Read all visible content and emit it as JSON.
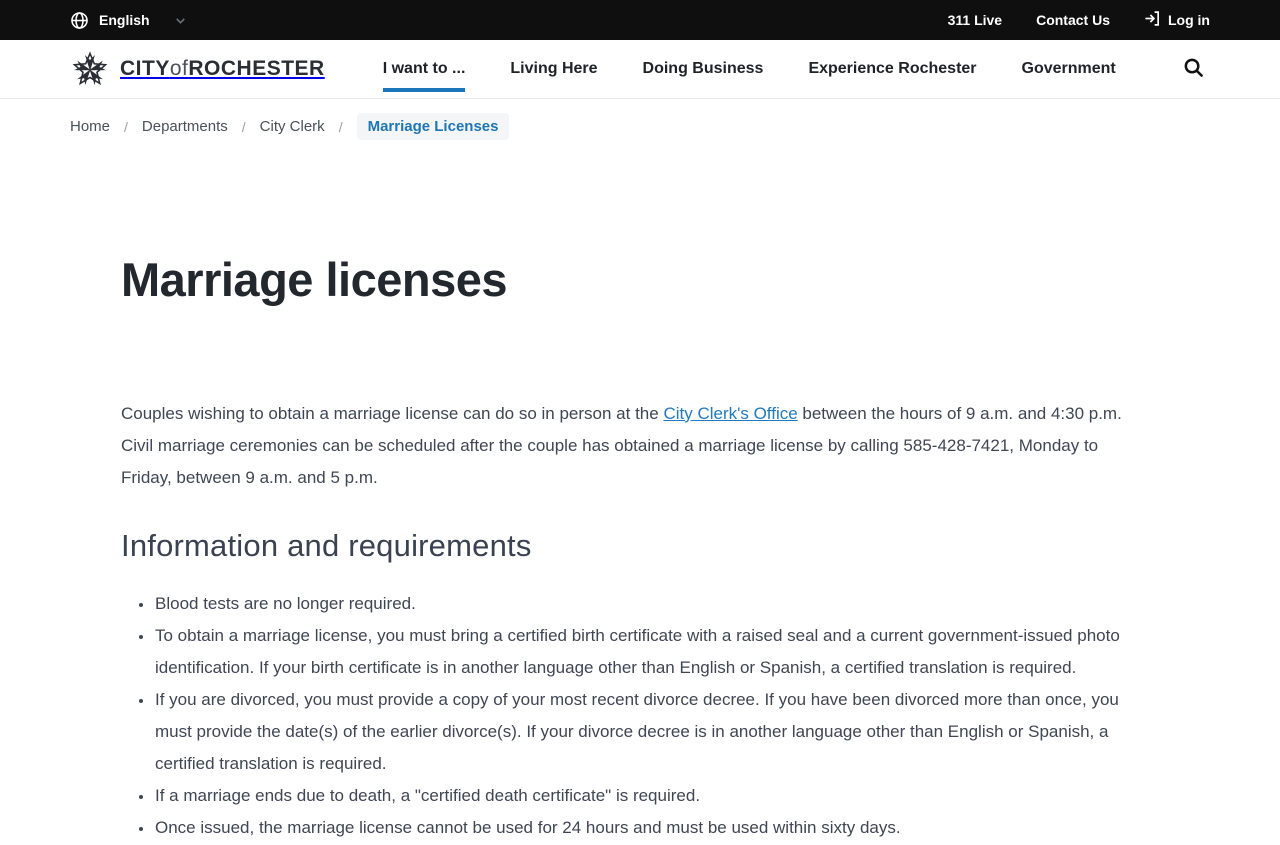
{
  "colors": {
    "accent_blue": "#1b75bb",
    "link_blue": "#2279bd",
    "topbar_bg": "#0f0f0f"
  },
  "top_bar": {
    "language": {
      "label": "English",
      "icon": "globe-icon"
    },
    "links": [
      {
        "label": "311 Live"
      },
      {
        "label": "Contact Us"
      },
      {
        "label": "Log in",
        "icon": "login-icon"
      }
    ]
  },
  "header": {
    "logo": {
      "word1": "CITY",
      "word2": "of",
      "word3": "ROCHESTER"
    },
    "nav": [
      {
        "label": "I want to ...",
        "active": true
      },
      {
        "label": "Living Here",
        "active": false
      },
      {
        "label": "Doing Business",
        "active": false
      },
      {
        "label": "Experience Rochester",
        "active": false
      },
      {
        "label": "Government",
        "active": false
      }
    ],
    "search_icon": "search-icon"
  },
  "breadcrumb": {
    "items": [
      {
        "label": "Home",
        "current": false
      },
      {
        "label": "Departments",
        "current": false
      },
      {
        "label": "City Clerk",
        "current": false
      },
      {
        "label": "Marriage Licenses",
        "current": true
      }
    ],
    "separator": "/"
  },
  "main": {
    "title": "Marriage licenses",
    "intro": {
      "before_link": "Couples wishing to obtain a marriage license can do so in person at the ",
      "link_text": "City Clerk's Office",
      "after_link": " between the hours of 9 a.m. and 4:30 p.m. Civil marriage ceremonies can be scheduled after the couple has obtained a marriage license by calling 585-428-7421, Monday to Friday, between 9 a.m. and 5 p.m."
    },
    "section_heading": "Information and requirements",
    "requirements": [
      "Blood tests are no longer required.",
      "To obtain a marriage license, you must bring a certified birth certificate with a raised seal and a current government-issued photo identification.  If your birth certificate is in another language other than English or Spanish, a certified translation is required.",
      "If you are divorced, you must provide a copy of your most recent divorce decree.  If you have been divorced more than once, you must provide the date(s) of the earlier divorce(s). If your divorce decree is in another language other than English or Spanish, a certified translation is required.",
      "If a marriage ends due to death, a \"certified death certificate\" is required.",
      "Once issued, the marriage license cannot be used for 24 hours and must be used within sixty days."
    ]
  }
}
